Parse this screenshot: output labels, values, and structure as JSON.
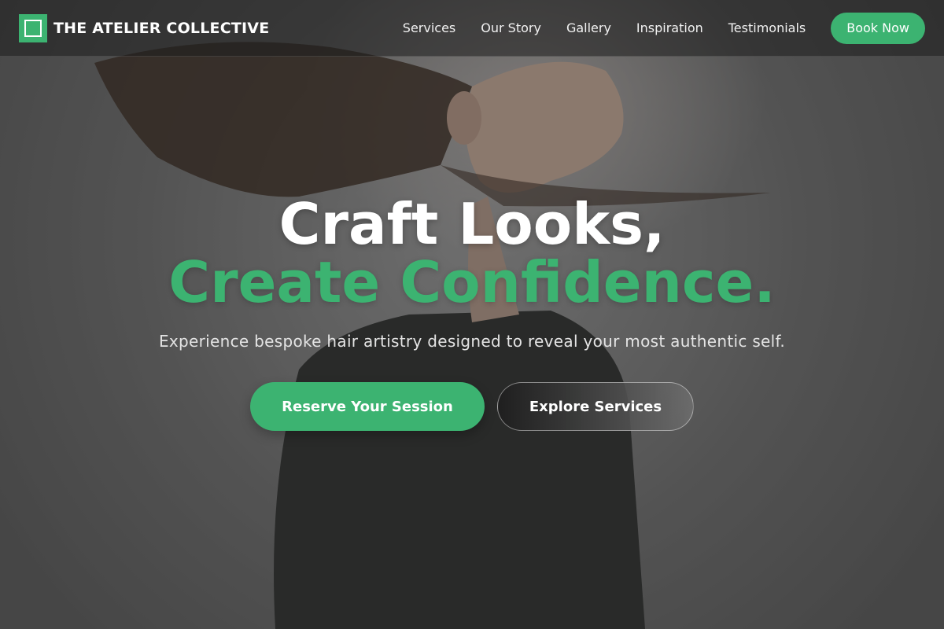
{
  "brand": {
    "name": "THE ATELIER COLLECTIVE",
    "logo_icon": "square-frame-icon",
    "accent_color": "#3cb371"
  },
  "nav": {
    "links": [
      "Services",
      "Our Story",
      "Gallery",
      "Inspiration",
      "Testimonials"
    ],
    "cta_label": "Book Now"
  },
  "hero": {
    "headline_line1": "Craft Looks,",
    "headline_line2": "Create Confidence.",
    "subtitle": "Experience bespoke hair artistry designed to reveal your most authentic self.",
    "primary_cta": "Reserve Your Session",
    "secondary_cta": "Explore Services"
  }
}
